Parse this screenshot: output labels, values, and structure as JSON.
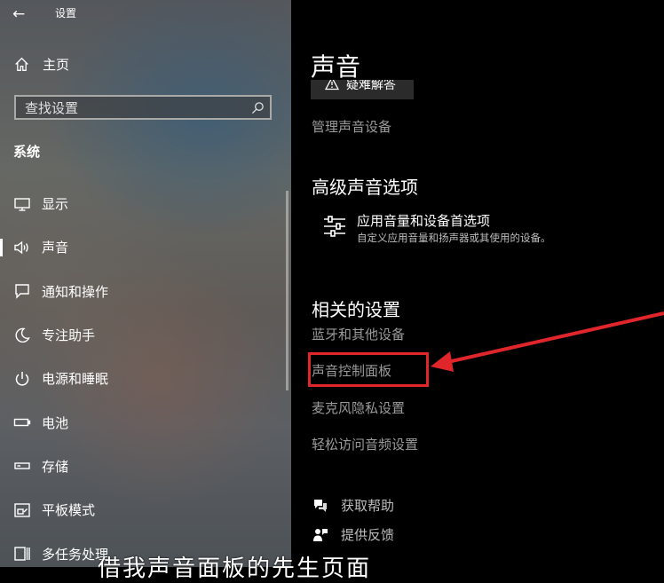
{
  "app": {
    "title": "设置",
    "back_icon": "arrow-left-icon"
  },
  "sidebar": {
    "home_label": "主页",
    "search_placeholder": "查找设置",
    "section_label": "系统",
    "items": [
      {
        "label": "显示",
        "icon": "monitor-icon"
      },
      {
        "label": "声音",
        "icon": "speaker-icon",
        "active": true
      },
      {
        "label": "通知和操作",
        "icon": "notification-icon"
      },
      {
        "label": "专注助手",
        "icon": "moon-icon"
      },
      {
        "label": "电源和睡眠",
        "icon": "power-icon"
      },
      {
        "label": "电池",
        "icon": "battery-icon"
      },
      {
        "label": "存储",
        "icon": "storage-icon"
      },
      {
        "label": "平板模式",
        "icon": "tablet-mode-icon"
      },
      {
        "label": "多任务处理",
        "icon": "multitasking-icon"
      }
    ]
  },
  "main": {
    "page_title": "声音",
    "troubleshoot_label": "疑难解答",
    "manage_devices_link": "管理声音设备",
    "advanced_heading": "高级声音选项",
    "advanced_option": {
      "title": "应用音量和设备首选项",
      "description": "自定义应用音量和扬声器或其使用的设备。"
    },
    "related_heading": "相关的设置",
    "related_links": [
      "蓝牙和其他设备",
      "声音控制面板",
      "麦克风隐私设置",
      "轻松访问音频设置"
    ],
    "help_links": [
      {
        "label": "获取帮助",
        "icon": "help-chat-icon"
      },
      {
        "label": "提供反馈",
        "icon": "feedback-icon"
      }
    ]
  },
  "annotation": {
    "color": "#e0252b"
  },
  "caption": "借我声音面板的先生页面"
}
